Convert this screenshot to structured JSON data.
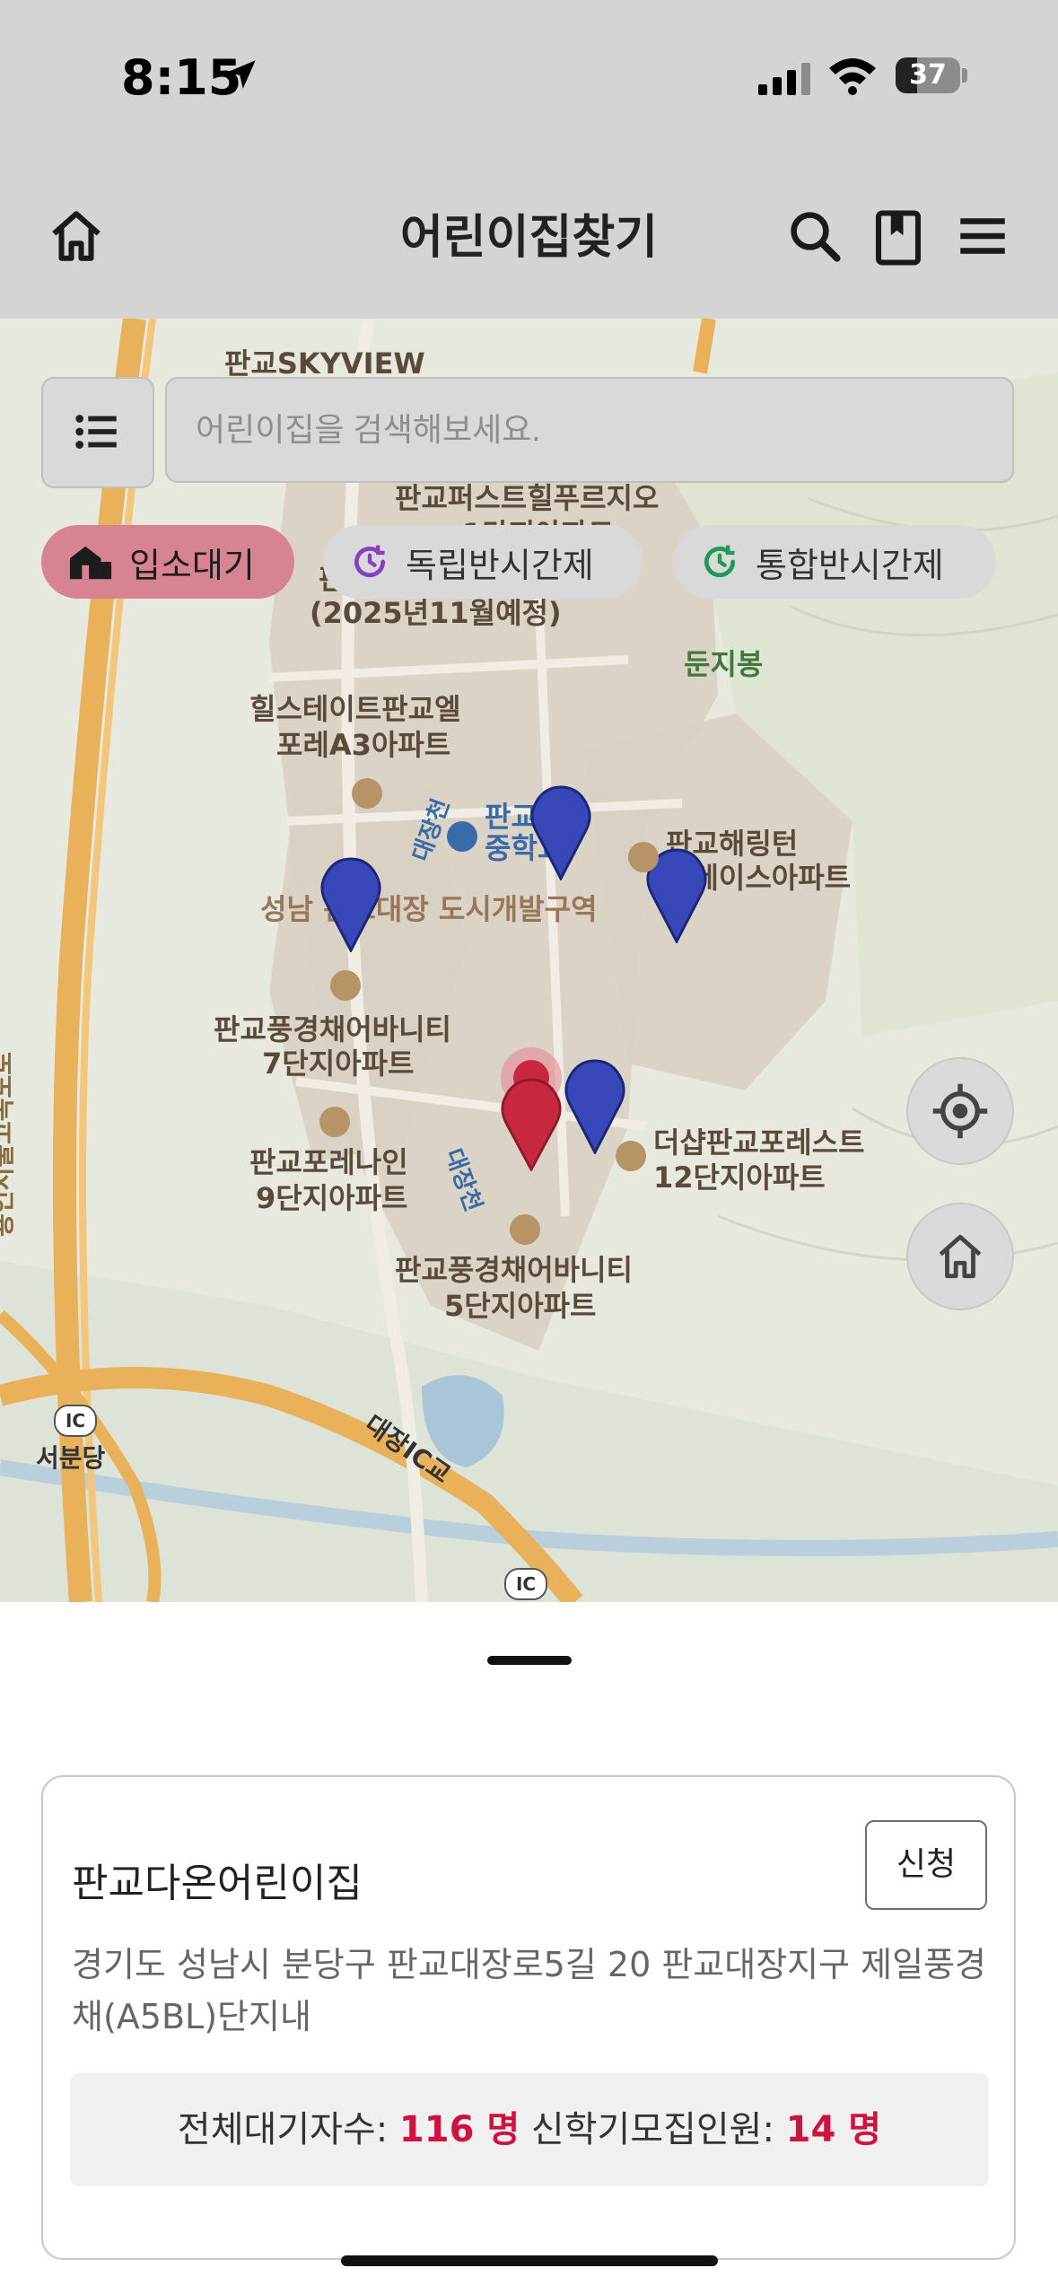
{
  "status_bar": {
    "time": "8:15",
    "battery": "37"
  },
  "header": {
    "title": "어린이집찾기"
  },
  "search": {
    "placeholder": "어린이집을 검색해보세요."
  },
  "filters": [
    {
      "label": "입소대기",
      "active": true
    },
    {
      "label": "독립반시간제",
      "active": false
    },
    {
      "label": "통합반시간제",
      "active": false
    }
  ],
  "map_labels": {
    "skyview": "판교SKYVIEW",
    "first_apt_1": "판교퍼스트힐푸르지오",
    "first_apt_2": "1단지아파트",
    "year_note_1": "판",
    "year_note_2": "(2025년11월예정)",
    "mountain": "둔지봉",
    "hillstate_1": "힐스테이트판교엘",
    "hillstate_2": "포레A3아파트",
    "school_1": "판교대장",
    "school_2": "중학교",
    "stream_1": "대장천",
    "harrington_1": "판교해링턴",
    "harrington_2": "플레이스아파트",
    "district": "성남 판교대장 도시개발구역",
    "highway": "용인서울고속도로",
    "pg7_1": "판교풍경채어바니티",
    "pg7_2": "7단지아파트",
    "forena_1": "판교포레나인",
    "forena_2": "9단지아파트",
    "stream_2": "대장천",
    "theshop_1": "더샵판교포레스트",
    "theshop_2": "12단지아파트",
    "pg5_1": "판교풍경채어바니티",
    "pg5_2": "5단지아파트",
    "ic_badge": "IC",
    "seobundang": "서분당",
    "daejang_ic": "대장IC교",
    "ic_badge_2": "IC"
  },
  "markers": [
    {
      "type": "facility",
      "color": "#3848b8"
    },
    {
      "type": "facility",
      "color": "#3848b8"
    },
    {
      "type": "facility",
      "color": "#3848b8"
    },
    {
      "type": "facility",
      "color": "#3848b8"
    },
    {
      "type": "selected",
      "color": "#c8283f"
    }
  ],
  "card": {
    "name": "판교다온어린이집",
    "apply_label": "신청",
    "address": "경기도 성남시 분당구 판교대장로5길 20 판교대장지구 제일풍경채(A5BL)단지내",
    "waiting_label": "전체대기자수:",
    "waiting_value": "116 명",
    "recruit_label": "신학기모집인원:",
    "recruit_value": "14 명"
  },
  "icons": [
    "home-icon",
    "search-icon",
    "bookmark-icon",
    "menu-icon",
    "list-icon",
    "building-icon",
    "clock-icon",
    "locate-icon",
    "home-outline-icon",
    "location-arrow-icon",
    "signal-icon",
    "wifi-icon"
  ]
}
